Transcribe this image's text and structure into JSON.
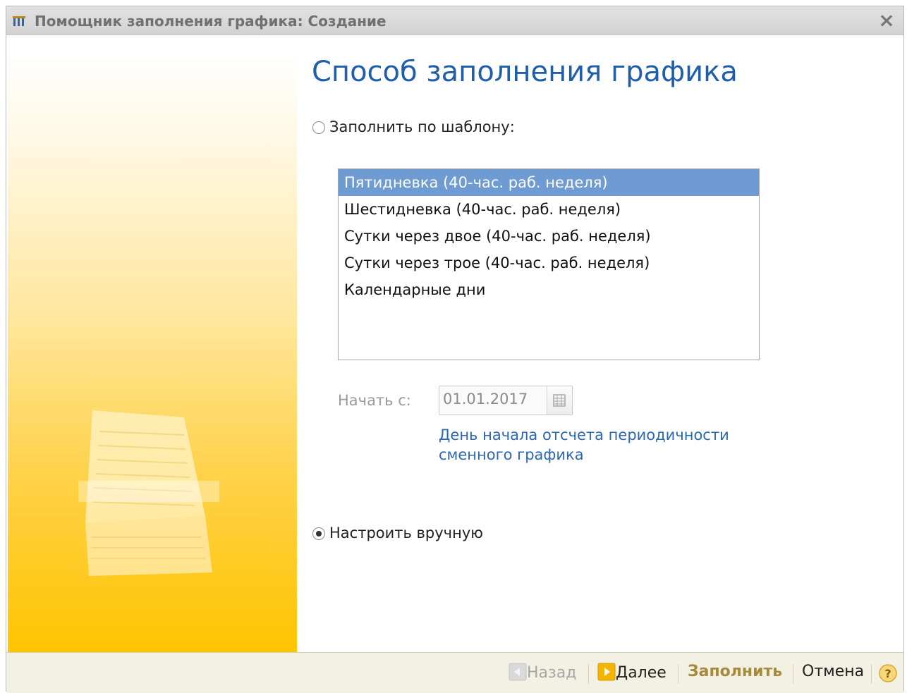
{
  "window": {
    "title": "Помощник заполнения графика: Создание"
  },
  "main": {
    "heading": "Способ заполнения графика",
    "template_option": {
      "label": "Заполнить по шаблону:",
      "checked": false
    },
    "templates": [
      {
        "label": "Пятидневка (40-час. раб. неделя)",
        "selected": true
      },
      {
        "label": "Шестидневка (40-час. раб. неделя)",
        "selected": false
      },
      {
        "label": "Сутки через двое (40-час. раб. неделя)",
        "selected": false
      },
      {
        "label": "Сутки через трое (40-час. раб. неделя)",
        "selected": false
      },
      {
        "label": "Календарные дни",
        "selected": false
      }
    ],
    "start_label": "Начать с:",
    "start_date": "01.01.2017",
    "hint": "День начала отсчета периодичности сменного графика",
    "manual_option": {
      "label": "Настроить вручную",
      "checked": true
    }
  },
  "footer": {
    "back": "Назад",
    "next": "Далее",
    "fill": "Заполнить",
    "cancel": "Отмена",
    "help": "?"
  },
  "colors": {
    "accent_blue": "#1f5ea8",
    "selection": "#6e9bd1",
    "panel_yellow": "#ffc400"
  }
}
